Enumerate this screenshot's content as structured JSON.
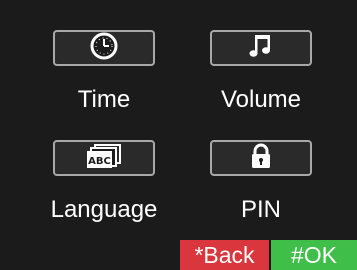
{
  "menu": {
    "items": [
      {
        "label": "Time",
        "icon": "clock-icon"
      },
      {
        "label": "Volume",
        "icon": "music-note-icon"
      },
      {
        "label": "Language",
        "icon": "abc-language-icon"
      },
      {
        "label": "PIN",
        "icon": "padlock-icon"
      }
    ]
  },
  "softkeys": {
    "back_label": "*Back",
    "ok_label": "#OK",
    "back_color": "#d9363e",
    "ok_color": "#3fbf4a"
  }
}
